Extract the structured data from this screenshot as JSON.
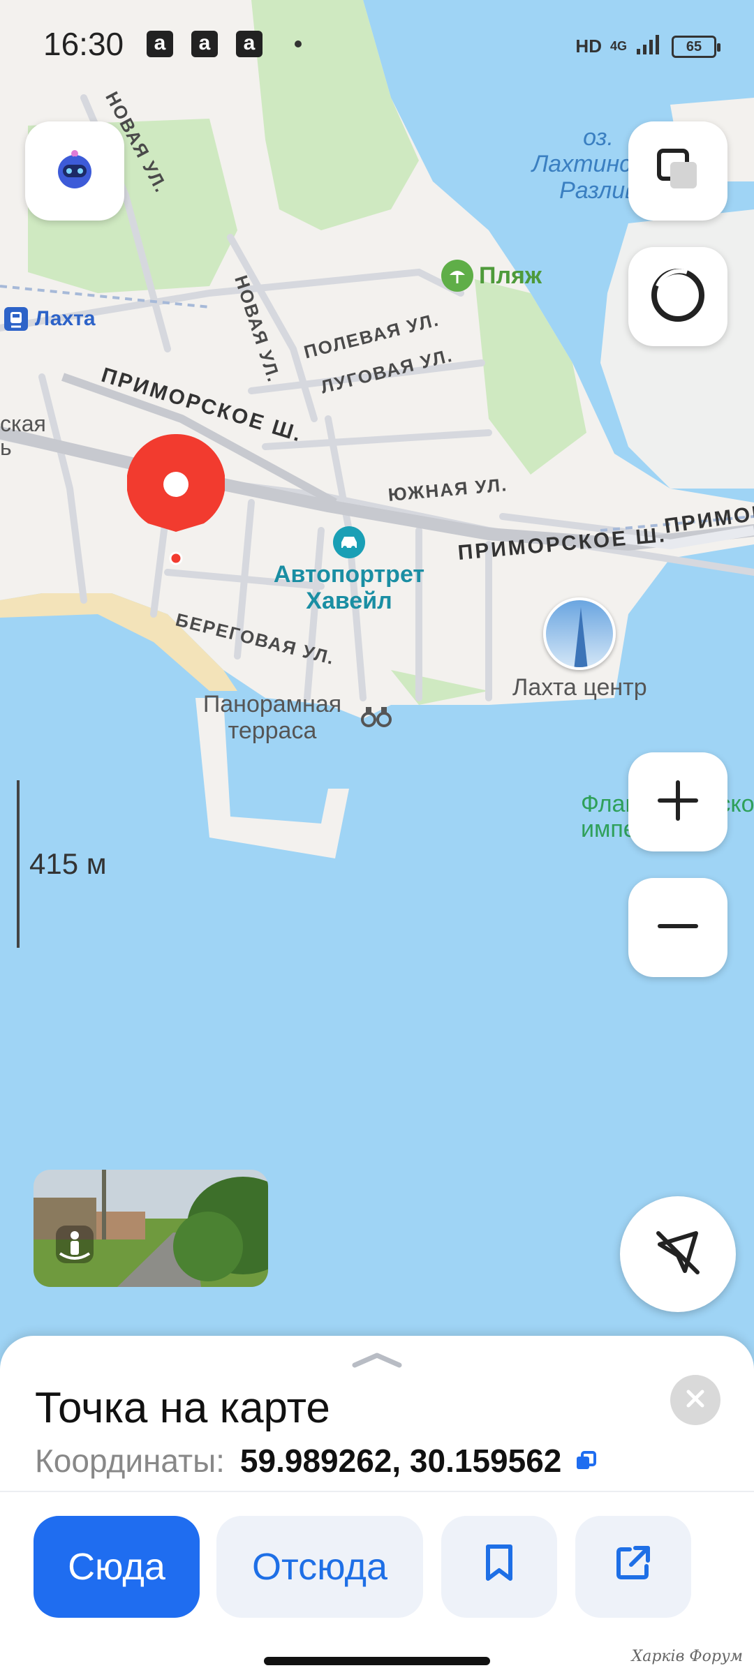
{
  "status_bar": {
    "time": "16:30",
    "notification_glyph": "a",
    "network_left": "HD",
    "network_type": "4G",
    "battery": "65"
  },
  "map": {
    "labels": {
      "lakhta_station": "Лахта",
      "lake_name": "оз. Лахтинский Разлив",
      "beach": "Пляж",
      "novaya_1": "НОВАЯ УЛ.",
      "novaya_2": "НОВАЯ УЛ.",
      "polevaya": "ПОЛЕВАЯ УЛ.",
      "lugovaya": "ЛУГОВАЯ УЛ.",
      "primorskoe_1": "ПРИМОРСКОЕ Ш.",
      "primorskoe_2": "ПРИМОРСКОЕ Ш.",
      "primorskoe_3": "ПРИМОР",
      "yuzhnaya": "ЮЖНАЯ УЛ.",
      "beregovaya": "БЕРЕГОВАЯ УЛ.",
      "district_fragment": "ская",
      "district_fragment2": "ь",
      "car_service": "Автопортрет Хавейл",
      "lakhta_center": "Лахта центр",
      "panorama_terrace": "Панорамная терраса",
      "flag": "Флаг Российской империи"
    },
    "scale_label": "415 м"
  },
  "controls": {
    "assistant_icon": "robot-assistant-icon",
    "layers_icon": "layers-icon",
    "alice_icon": "alice-ring-icon",
    "zoom_in_icon": "plus-icon",
    "zoom_out_icon": "minus-icon",
    "location_icon": "location-off-icon",
    "panorama_icon": "street-view-icon"
  },
  "sheet": {
    "title": "Точка на карте",
    "coords_label": "Координаты:",
    "coords_value": "59.989262, 30.159562",
    "actions": {
      "here": "Сюда",
      "from": "Отсюда"
    }
  },
  "watermark": "Харків Форум",
  "colors": {
    "water": "#9fd4f5",
    "land": "#f3f1ee",
    "park": "#cfe9c1",
    "primary": "#1f6df0",
    "pin": "#f23b2f"
  }
}
